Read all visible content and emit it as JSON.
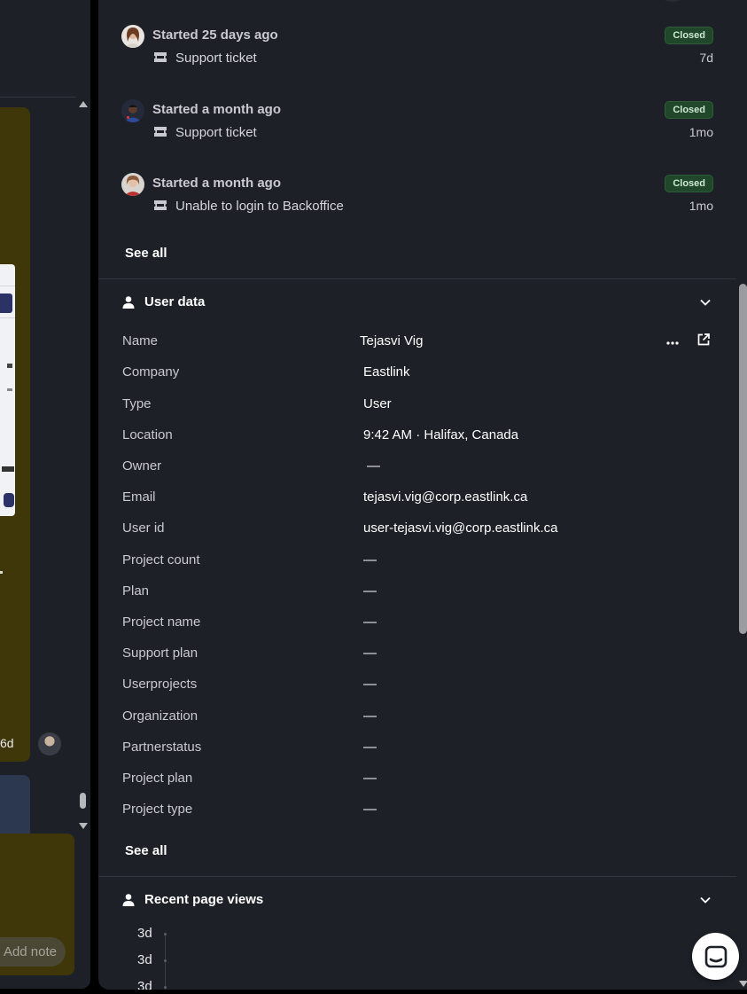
{
  "left_panel": {
    "time_label": "6d",
    "add_note_label": "Add note"
  },
  "conversations": [
    {
      "title": "Started 25 days ago",
      "subtitle": "Support ticket",
      "status": "Closed",
      "age": "7d",
      "avatar": "woman-avatar-1"
    },
    {
      "title": "Started a month ago",
      "subtitle": "Support ticket",
      "status": "Closed",
      "age": "1mo",
      "avatar": "man-avatar"
    },
    {
      "title": "Started a month ago",
      "subtitle": "Unable to login to Backoffice",
      "status": "Closed",
      "age": "1mo",
      "avatar": "woman-avatar-2"
    }
  ],
  "conversations_see_all": "See all",
  "user_data": {
    "header": "User data",
    "rows": [
      {
        "key": "Name",
        "value": "Tejasvi Vig"
      },
      {
        "key": "Company",
        "value": "Eastlink"
      },
      {
        "key": "Type",
        "value": "User"
      },
      {
        "key": "Location",
        "value": "9:42 AM · Halifax, Canada"
      },
      {
        "key": "Owner",
        "value": "—"
      },
      {
        "key": "Email",
        "value": "tejasvi.vig@corp.eastlink.ca"
      },
      {
        "key": "User id",
        "value": "user-tejasvi.vig@corp.eastlink.ca"
      },
      {
        "key": "Project count",
        "value": "—"
      },
      {
        "key": "Plan",
        "value": "—"
      },
      {
        "key": "Project name",
        "value": "—"
      },
      {
        "key": "Support plan",
        "value": "—"
      },
      {
        "key": "Userprojects",
        "value": "—"
      },
      {
        "key": "Organization",
        "value": "—"
      },
      {
        "key": "Partnerstatus",
        "value": "—"
      },
      {
        "key": "Project plan",
        "value": "—"
      },
      {
        "key": "Project type",
        "value": "—"
      }
    ],
    "see_all": "See all"
  },
  "recent_page_views": {
    "header": "Recent page views",
    "items": [
      "3d",
      "3d",
      "3d"
    ]
  },
  "colors": {
    "panel_bg": "#1e2028",
    "closed_badge_bg": "#20472a",
    "note_bg": "#3f370a"
  }
}
